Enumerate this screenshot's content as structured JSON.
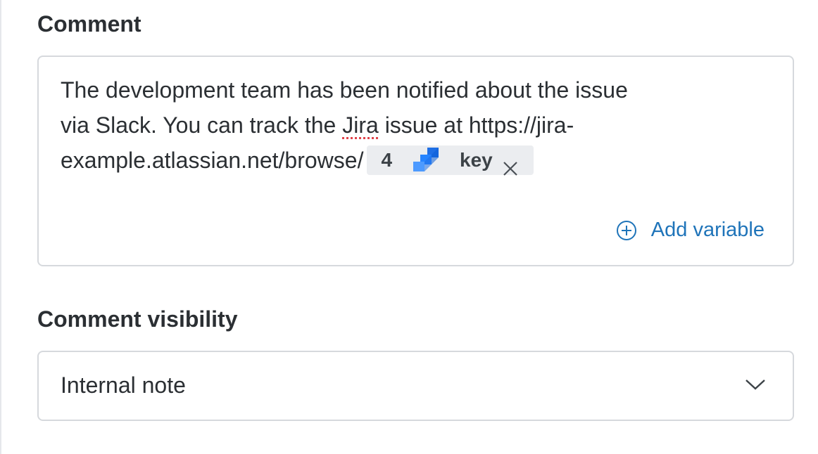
{
  "comment": {
    "label": "Comment",
    "text_line1": "The development team has been notified about the issue",
    "text_line2_before": "via Slack. You can track the ",
    "text_line2_misspelled": "Jira",
    "text_line2_after": " issue at https://jira-",
    "text_line3": "example.atlassian.net/browse/",
    "variable_chip": {
      "step_number": "4",
      "icon": "jira-icon",
      "field": "key",
      "remove_icon": "close-icon"
    },
    "add_variable": {
      "icon": "plus-circle-icon",
      "label": "Add variable"
    }
  },
  "visibility": {
    "label": "Comment visibility",
    "selected_value": "Internal note",
    "icon": "chevron-down-icon"
  },
  "colors": {
    "text": "#2b2f33",
    "link": "#1f74b9",
    "border": "#d6d9dd",
    "chip_bg": "#ebedf0",
    "jira_blue": "#2684ff",
    "spellcheck": "#e0434b"
  }
}
